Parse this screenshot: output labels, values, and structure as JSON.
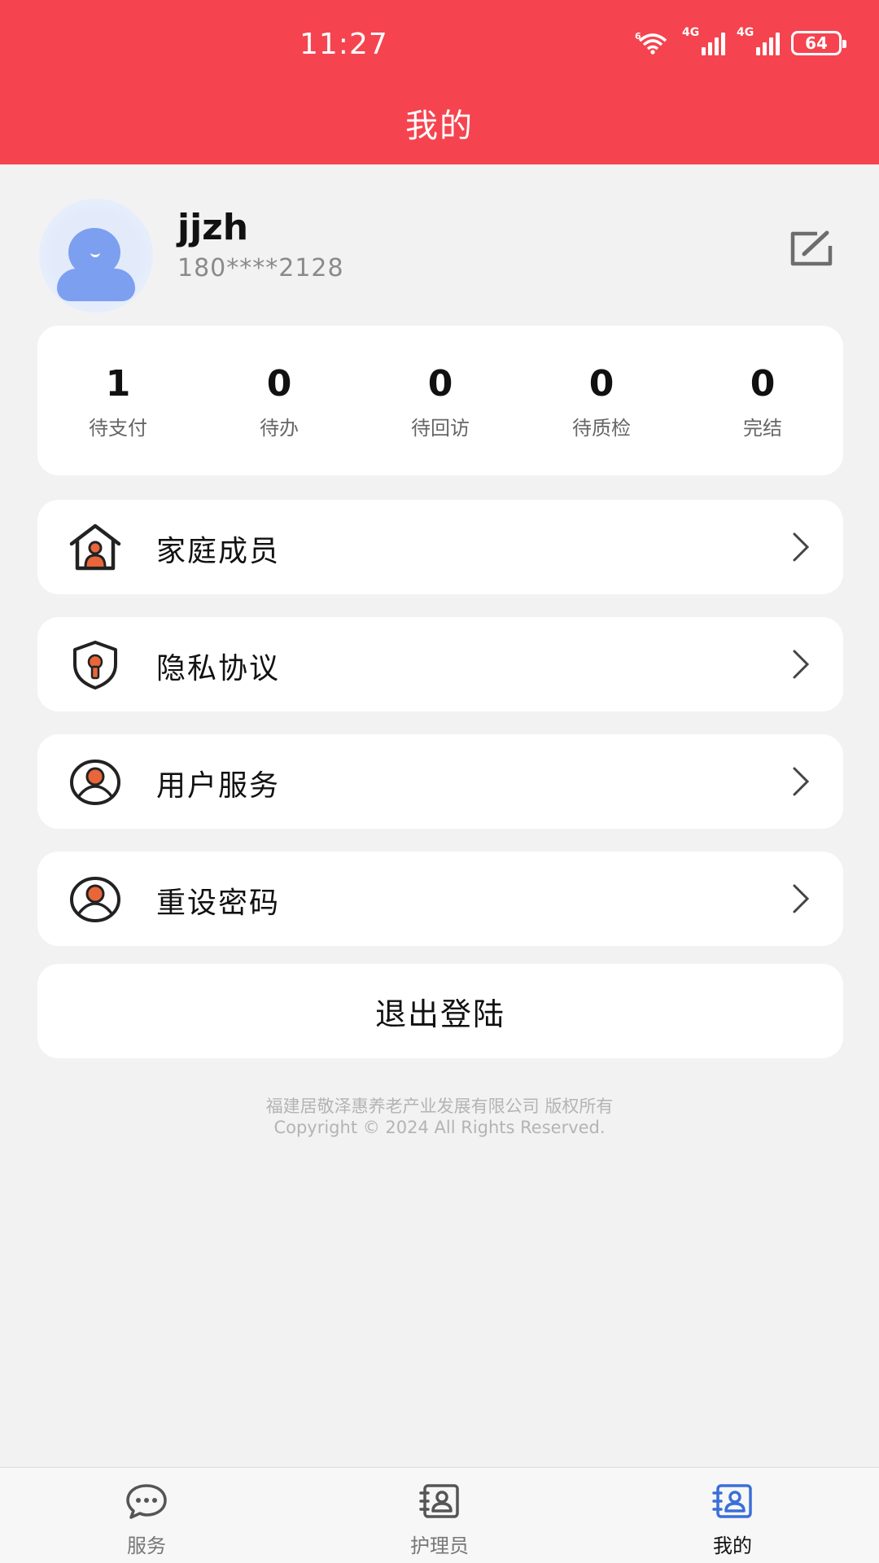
{
  "status_bar": {
    "time": "11:27",
    "battery": "64",
    "network_1": "4G",
    "network_2": "4G",
    "wifi_badge": "6"
  },
  "header": {
    "title": "我的"
  },
  "profile": {
    "username": "jjzh",
    "phone": "180****2128"
  },
  "stats": [
    {
      "value": "1",
      "label": "待支付"
    },
    {
      "value": "0",
      "label": "待办"
    },
    {
      "value": "0",
      "label": "待回访"
    },
    {
      "value": "0",
      "label": "待质检"
    },
    {
      "value": "0",
      "label": "完结"
    }
  ],
  "menu": [
    {
      "label": "家庭成员",
      "icon": "house-person-icon"
    },
    {
      "label": "隐私协议",
      "icon": "shield-lock-icon"
    },
    {
      "label": "用户服务",
      "icon": "user-circle-icon"
    },
    {
      "label": "重设密码",
      "icon": "user-circle-icon"
    }
  ],
  "logout_label": "退出登陆",
  "footer": {
    "company": "福建居敬泽惠养老产业发展有限公司 版权所有",
    "copyright": "Copyright © 2024 All Rights Reserved."
  },
  "tabs": [
    {
      "label": "服务",
      "icon": "chat-bubble-icon",
      "active": false
    },
    {
      "label": "护理员",
      "icon": "contact-book-icon",
      "active": false
    },
    {
      "label": "我的",
      "icon": "contact-book-icon",
      "active": true
    }
  ],
  "colors": {
    "accent": "#f5444f",
    "active_tab_icon": "#3b6fd8",
    "icon_orange": "#e8663a"
  }
}
